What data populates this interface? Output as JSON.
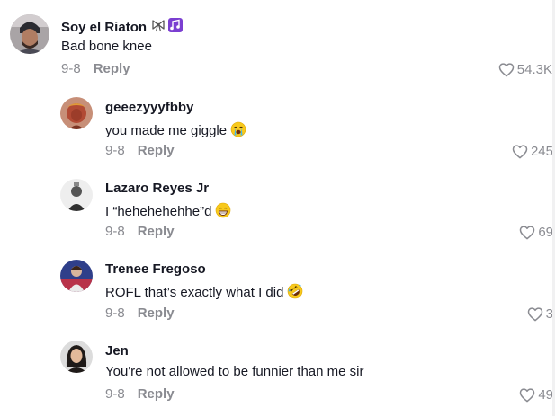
{
  "comments": [
    {
      "username": "Soy el Riaton",
      "badge_icons": [
        "bow-icon",
        "music-notes-icon"
      ],
      "text": "Bad bone knee",
      "date": "9-8",
      "reply_label": "Reply",
      "likes": "54.3K"
    }
  ],
  "replies": [
    {
      "username": "geeezyyyfbby",
      "text": "you made me giggle",
      "emoji": "loudly-crying-face-icon",
      "date": "9-8",
      "reply_label": "Reply",
      "likes": "245"
    },
    {
      "username": "Lazaro Reyes Jr",
      "text": "I “hehehehehhe”d",
      "emoji": "grinning-face-icon",
      "date": "9-8",
      "reply_label": "Reply",
      "likes": "69"
    },
    {
      "username": "Trenee Fregoso",
      "text": "ROFL that’s exactly what I did",
      "emoji": "rolling-on-floor-laughing-icon",
      "date": "9-8",
      "reply_label": "Reply",
      "likes": "3"
    },
    {
      "username": "Jen",
      "text": "You're not allowed to be funnier than me sir",
      "date": "9-8",
      "reply_label": "Reply",
      "likes": "49"
    }
  ],
  "colors": {
    "text": "#161823",
    "muted": "#8a8b91",
    "badge": "#7b3fd1"
  }
}
